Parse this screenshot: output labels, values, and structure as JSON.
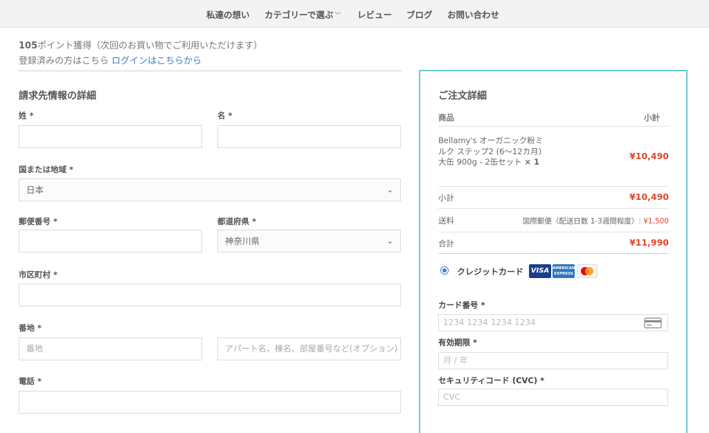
{
  "nav": {
    "items": [
      {
        "label": "私達の想い"
      },
      {
        "label": "カテゴリーで選ぶ"
      },
      {
        "label": "レビュー"
      },
      {
        "label": "ブログ"
      },
      {
        "label": "お問い合わせ"
      }
    ]
  },
  "info": {
    "points_value": "105",
    "points_text": "ポイント獲得（次回のお買い物でご利用いただけます）",
    "login_prefix": "登録済みの方はこちら",
    "login_link": "ログインはこちらから"
  },
  "billing": {
    "title": "請求先情報の詳細",
    "last_name_label": "姓 *",
    "first_name_label": "名 *",
    "country_label": "国または地域 *",
    "country_value": "日本",
    "postcode_label": "郵便番号 *",
    "prefecture_label": "都道府県 *",
    "prefecture_value": "神奈川県",
    "city_label": "市区町村 *",
    "address_label": "番地 *",
    "address1_placeholder": "番地",
    "address2_placeholder": "アパート名、棟名、部屋番号など(オプション)",
    "phone_label": "電話 *"
  },
  "order": {
    "title": "ご注文詳細",
    "col_product": "商品",
    "col_subtotal": "小計",
    "product_name": "Bellamy's オーガニック粉ミルク ステップ2 (6〜12カ月) 大缶 900g - 2缶セット",
    "product_qty": "× 1",
    "product_price": "¥10,490",
    "subtotal_label": "小計",
    "subtotal_value": "¥10,490",
    "shipping_label": "送料",
    "shipping_method": "国際郵便（配送日数 1-3週間程度）:",
    "shipping_value": "¥1,500",
    "total_label": "合計",
    "total_value": "¥11,990"
  },
  "payment": {
    "method_label": "クレジットカード",
    "card_logos": {
      "visa": "VISA",
      "amex": "AMERICAN EXPRESS"
    },
    "card_number_label": "カード番号 *",
    "card_number_placeholder": "1234 1234 1234 1234",
    "expiry_label": "有効期限 *",
    "expiry_placeholder": "月 / 年",
    "cvc_label": "セキュリティコード (CVC) *",
    "cvc_placeholder": "CVC"
  },
  "colors": {
    "accent_link": "#3b7fc4",
    "price_red": "#e3452a",
    "panel_border": "#6cc5d4"
  }
}
